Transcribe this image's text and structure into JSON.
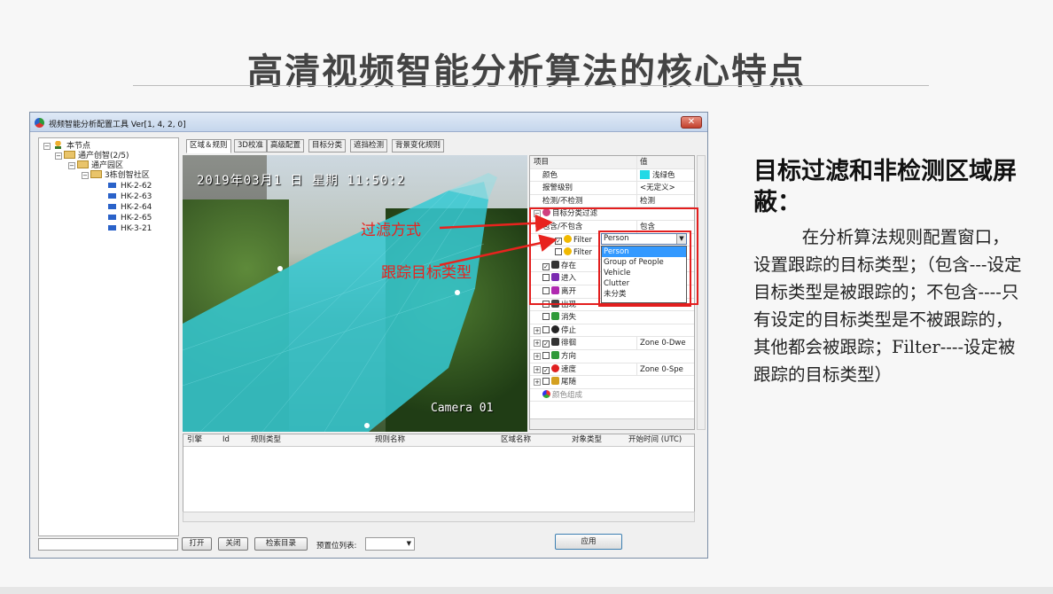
{
  "slide": {
    "title": "高清视频智能分析算法的核心特点",
    "heading": "目标过滤和非检测区域屏蔽：",
    "body": "在分析算法规则配置窗口，设置跟踪的目标类型；（包含---设定目标类型是被跟踪的；不包含----只有设定的目标类型是不被跟踪的，其他都会被跟踪；Filter----设定被跟踪的目标类型）"
  },
  "window": {
    "title": "视频智能分析配置工具 Ver[1, 4, 2, 0]",
    "close": "✕"
  },
  "tree": {
    "root": "本节点",
    "n1": "通产创智(2/5)",
    "n2": "通产园区",
    "n3": "3栋创智社区",
    "cams": [
      "HK-2-62",
      "HK-2-63",
      "HK-2-64",
      "HK-2-65",
      "HK-3-21"
    ]
  },
  "tabs": [
    "区域＆规则",
    "3D校准",
    "高级配置",
    "目标分类",
    "遮挡检测",
    "背景变化规则"
  ],
  "video": {
    "timestamp": "2019年03月1 日 星期  11:50:2",
    "camera": "Camera 01"
  },
  "annotations": {
    "filter_mode": "过滤方式",
    "track_type": "跟踪目标类型"
  },
  "props": {
    "header_k": "项目",
    "header_v": "值",
    "color_k": "颜色",
    "color_v": "浅绿色",
    "alarm_k": "报警级别",
    "alarm_v": "<无定义>",
    "detect_k": "检测/不检测",
    "detect_v": "检测",
    "filter_group": "目标分类过滤",
    "include_k": "包含/不包含",
    "include_v": "包含",
    "filter1": "Filter",
    "filter2": "Filter",
    "r_exist": "存在",
    "r_enter": "进入",
    "r_leave": "离开",
    "r_appear": "出现",
    "r_vanish": "消失",
    "r_stop": "停止",
    "r_loiter": "徘徊",
    "r_loiter_v": "Zone 0-Dwe",
    "r_dir": "方向",
    "r_speed": "速度",
    "r_speed_v": "Zone 0-Spe",
    "r_tail": "尾随",
    "r_color": "颜色组成"
  },
  "dropdown": {
    "value": "Person",
    "options": [
      "Person",
      "Group of People",
      "Vehicle",
      "Clutter",
      "未分类"
    ]
  },
  "table_headers": [
    "引擎",
    "Id",
    "规则类型",
    "规则名称",
    "区域名称",
    "对象类型",
    "开始时间 (UTC)"
  ],
  "buttons": {
    "open": "打开",
    "close": "关闭",
    "search": "检索目录",
    "preset_label": "预置位列表:",
    "apply": "应用"
  }
}
